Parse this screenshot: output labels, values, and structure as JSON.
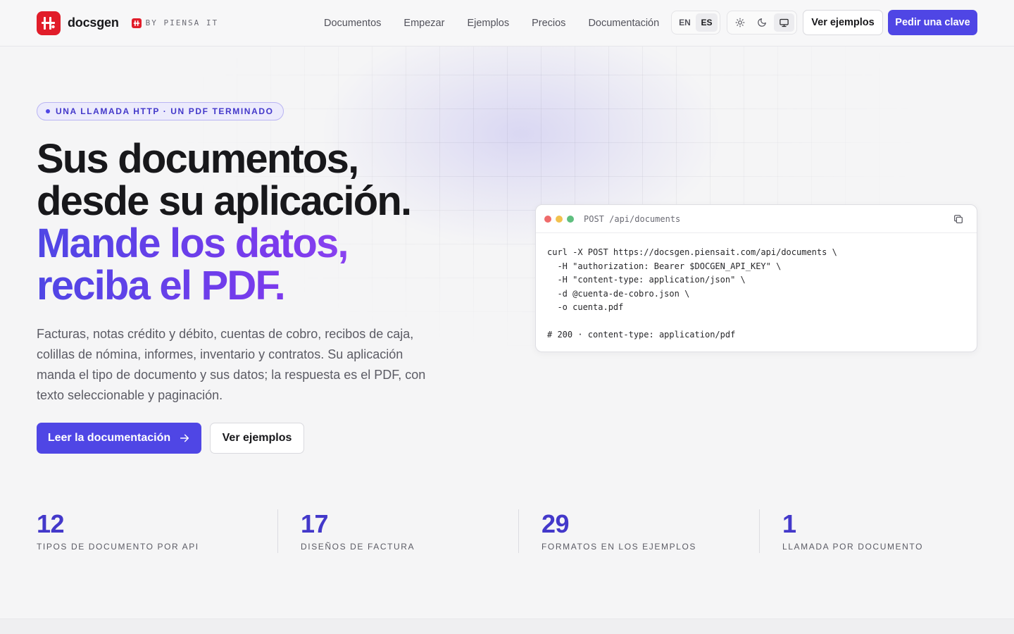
{
  "header": {
    "brand": "docsgen",
    "byline": "BY PIENSA IT",
    "nav": [
      "Documentos",
      "Empezar",
      "Ejemplos",
      "Precios",
      "Documentación"
    ],
    "lang": [
      "EN",
      "ES"
    ],
    "lang_active": "ES",
    "theme_options": [
      "sun-icon",
      "moon-icon",
      "monitor-icon"
    ],
    "examples_button": "Ver ejemplos",
    "cta_button": "Pedir una clave"
  },
  "hero": {
    "pill": "UNA LLAMADA HTTP · UN PDF TERMINADO",
    "headline_line1": "Sus documentos,",
    "headline_line2": "desde su aplicación.",
    "headline_line3": "Mande los datos,",
    "headline_line4": "reciba el PDF.",
    "lede": "Facturas, notas crédito y débito, cuentas de cobro, recibos de caja, colillas de nómina, informes, inventario y contratos. Su aplicación manda el tipo de documento y sus datos; la respuesta es el PDF, con texto seleccionable y paginación.",
    "primary_button": "Leer la documentación",
    "secondary_button": "Ver ejemplos"
  },
  "code": {
    "title": "POST /api/documents",
    "lines": [
      "curl -X POST https://docsgen.piensait.com/api/documents \\",
      "  -H \"authorization: Bearer $DOCGEN_API_KEY\" \\",
      "  -H \"content-type: application/json\" \\",
      "  -d @cuenta-de-cobro.json \\",
      "  -o cuenta.pdf",
      "",
      "# 200 · content-type: application/pdf"
    ]
  },
  "stats": [
    {
      "value": "12",
      "label": "TIPOS DE DOCUMENTO POR API"
    },
    {
      "value": "17",
      "label": "DISEÑOS DE FACTURA"
    },
    {
      "value": "29",
      "label": "FORMATOS EN LOS EJEMPLOS"
    },
    {
      "value": "1",
      "label": "LLAMADA POR DOCUMENTO"
    }
  ],
  "colors": {
    "accent": "#4f46e5",
    "brand_red": "#e11d2a",
    "stat_number": "#4338ca"
  }
}
